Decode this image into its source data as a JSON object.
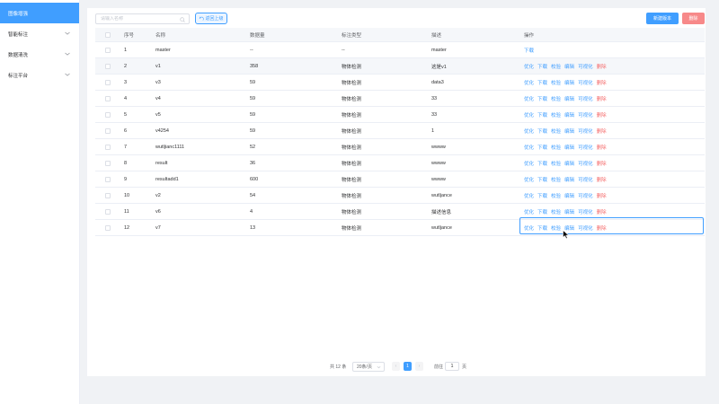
{
  "sidebar": {
    "items": [
      {
        "label": "图像增强",
        "active": true
      },
      {
        "label": "智能标注",
        "expandable": true
      },
      {
        "label": "数据清洗",
        "expandable": true
      },
      {
        "label": "标注平台",
        "expandable": true
      }
    ]
  },
  "toolbar": {
    "search_placeholder": "请输入名称",
    "search_value": "",
    "back_label": "返回上级",
    "new_version_label": "新建版本",
    "delete_label": "删除"
  },
  "table": {
    "headers": {
      "index": "序号",
      "name": "名称",
      "count": "数据量",
      "type": "标注类型",
      "desc": "描述",
      "ops": "操作"
    },
    "op_labels": {
      "optimize": "优化",
      "download": "下载",
      "verify": "校验",
      "edit": "编辑",
      "visualize": "可视化",
      "delete": "删除"
    },
    "rows": [
      {
        "index": "1",
        "name": "master",
        "count": "--",
        "type": "--",
        "desc": "master"
      },
      {
        "index": "2",
        "name": "v1",
        "count": "358",
        "type": "物体检测",
        "desc": "这是v1"
      },
      {
        "index": "3",
        "name": "v3",
        "count": "59",
        "type": "物体检测",
        "desc": "data3"
      },
      {
        "index": "4",
        "name": "v4",
        "count": "59",
        "type": "物体检测",
        "desc": "33"
      },
      {
        "index": "5",
        "name": "v5",
        "count": "59",
        "type": "物体检测",
        "desc": "33"
      },
      {
        "index": "6",
        "name": "v4254",
        "count": "59",
        "type": "物体检测",
        "desc": "1"
      },
      {
        "index": "7",
        "name": "wutljianc1111",
        "count": "52",
        "type": "物体检测",
        "desc": "wwww"
      },
      {
        "index": "8",
        "name": "result",
        "count": "36",
        "type": "物体检测",
        "desc": "wwww"
      },
      {
        "index": "9",
        "name": "resultadd1",
        "count": "600",
        "type": "物体检测",
        "desc": "wwww"
      },
      {
        "index": "10",
        "name": "v2",
        "count": "54",
        "type": "物体检测",
        "desc": "wutljance"
      },
      {
        "index": "11",
        "name": "v6",
        "count": "4",
        "type": "物体检测",
        "desc": "描述信息"
      },
      {
        "index": "12",
        "name": "v7",
        "count": "13",
        "type": "物体检测",
        "desc": "wutljance"
      }
    ]
  },
  "pagination": {
    "total_text": "共 12 条",
    "page_size": "20条/页",
    "current_page": "1",
    "goto_label": "前往",
    "goto_value": "1",
    "page_suffix": "页",
    "prev_symbol": "‹",
    "next_symbol": "›"
  },
  "colors": {
    "primary": "#409eff",
    "danger": "#f56c6c",
    "danger_button": "#f78989"
  }
}
